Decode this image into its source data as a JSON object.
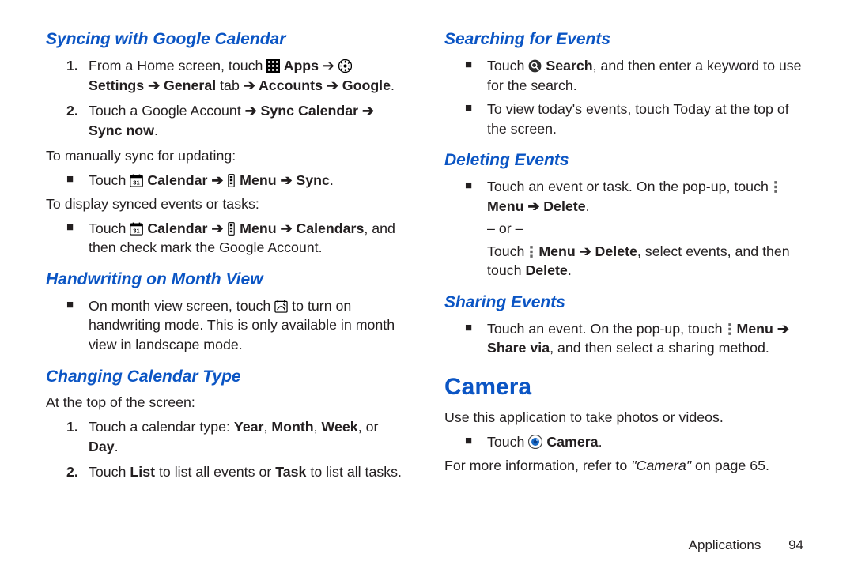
{
  "left": {
    "h_sync": "Syncing with Google Calendar",
    "step1_a": "From a Home screen, touch ",
    "step1_apps": " Apps",
    "step1_arrow1": " ➔ ",
    "step1_settings": " Settings",
    "step1_arrow2": " ➔ ",
    "step1_general": "General",
    "step1_tab": " tab ",
    "step1_arrow3": "➔ ",
    "step1_accounts": "Accounts",
    "step1_arrow4": " ➔ ",
    "step1_google": "Google",
    "step1_end": ".",
    "step2_a": "Touch a Google Account ",
    "step2_arrow1": "➔ ",
    "step2_synccal": "Sync Calendar",
    "step2_arrow2": " ➔ ",
    "step2_syncnow": "Sync now",
    "step2_end": ".",
    "manual": "To manually sync for updating:",
    "msync_a": "Touch ",
    "msync_cal": " Calendar",
    "msync_arrow1": " ➔ ",
    "msync_menu": " Menu",
    "msync_arrow2": " ➔ ",
    "msync_sync": "Sync",
    "msync_end": ".",
    "display": "To display synced events or tasks:",
    "dsync_a": "Touch ",
    "dsync_cal": " Calendar",
    "dsync_arrow1": " ➔ ",
    "dsync_menu": " Menu",
    "dsync_arrow2": " ➔ ",
    "dsync_calendars": "Calendars",
    "dsync_end": ", and then check mark the Google Account.",
    "h_hand": "Handwriting on Month View",
    "hand_a": "On month view screen, touch ",
    "hand_end": " to turn on handwriting mode. This is only available in month view in landscape mode.",
    "h_type": "Changing Calendar Type",
    "type_intro": "At the top of the screen:",
    "type1_a": "Touch a calendar type: ",
    "type1_year": "Year",
    "type1_c1": ", ",
    "type1_month": "Month",
    "type1_c2": ", ",
    "type1_week": "Week",
    "type1_c3": ", or ",
    "type1_day": "Day",
    "type1_end": ".",
    "type2_a": "Touch ",
    "type2_list": "List",
    "type2_mid": " to list all events or ",
    "type2_task": "Task",
    "type2_end": " to list all tasks."
  },
  "right": {
    "h_search": "Searching for Events",
    "search_a": "Touch ",
    "search_b": " Search",
    "search_end": ", and then enter a keyword to use for the search.",
    "today": "To view today's events, touch Today at the top of the screen.",
    "h_del": "Deleting Events",
    "del_a": "Touch an event or task. On the pop-up, touch ",
    "del_menu": " Menu",
    "del_arrow": " ➔ ",
    "del_delete": "Delete",
    "del_end": ".",
    "or": "– or –",
    "del2_a": "Touch ",
    "del2_menu": " Menu",
    "del2_arrow": " ➔ ",
    "del2_delete": "Delete",
    "del2_mid": ", select events, and then touch ",
    "del2_delete2": "Delete",
    "del2_end": ".",
    "h_share": "Sharing Events",
    "share_a": "Touch an event. On the pop-up, touch ",
    "share_menu": " Menu",
    "share_arrow": " ➔ ",
    "share_sharevia": "Share via",
    "share_end": ", and then select a sharing method.",
    "h_camera": "Camera",
    "cam_intro": "Use this application to take photos or videos.",
    "cam_touch": "Touch ",
    "cam_label": " Camera",
    "cam_end": ".",
    "ref_a": "For more information, refer to ",
    "ref_q": "\"Camera\"",
    "ref_end": " on page 65."
  },
  "footer": {
    "section": "Applications",
    "page": "94"
  },
  "glyph": {
    "arrow": "➔",
    "square": "■"
  }
}
